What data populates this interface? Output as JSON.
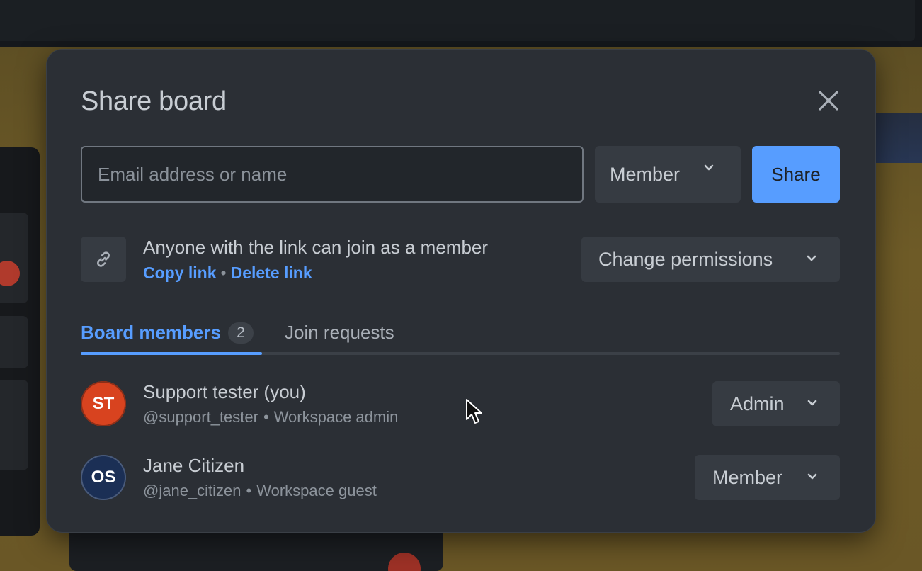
{
  "dialog": {
    "title": "Share board",
    "close_icon": "close-icon"
  },
  "invite": {
    "email_placeholder": "Email address or name",
    "email_value": "",
    "role_selected": "Member",
    "share_label": "Share"
  },
  "link_sharing": {
    "icon": "link-icon",
    "description": "Anyone with the link can join as a member",
    "copy_label": "Copy link",
    "separator": "•",
    "delete_label": "Delete link",
    "permissions_label": "Change permissions"
  },
  "tabs": {
    "members_label": "Board members",
    "members_count": "2",
    "requests_label": "Join requests",
    "active": "Board members"
  },
  "members": [
    {
      "initials": "ST",
      "name": "Support tester (you)",
      "username": "@support_tester",
      "separator": "•",
      "workspace_role": "Workspace admin",
      "board_role": "Admin",
      "avatar_color": "#d8431f"
    },
    {
      "initials": "OS",
      "name": "Jane Citizen",
      "username": "@jane_citizen",
      "separator": "•",
      "workspace_role": "Workspace guest",
      "board_role": "Member",
      "avatar_color": "#1b2f55"
    }
  ],
  "colors": {
    "accent": "#579dff",
    "dialog_bg": "#2b2f35",
    "text": "#c8cdd3",
    "muted": "#8d949c"
  }
}
